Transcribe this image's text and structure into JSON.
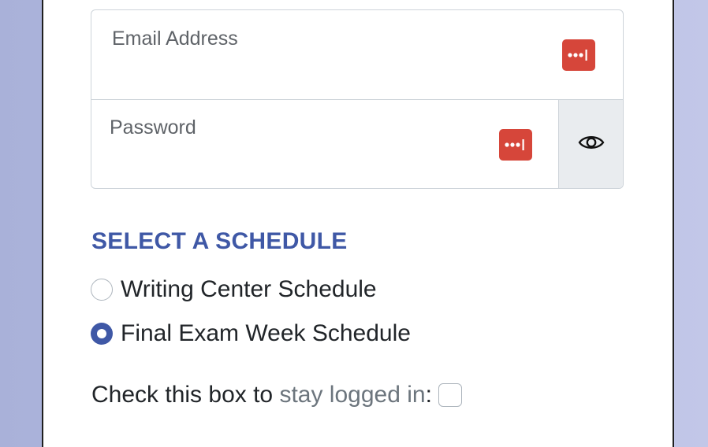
{
  "login": {
    "email": {
      "label": "Email Address",
      "value": ""
    },
    "password": {
      "label": "Password",
      "value": ""
    },
    "icons": {
      "password_manager": "password-manager-icon",
      "show_password": "eye-icon"
    }
  },
  "schedule": {
    "heading": "SELECT A SCHEDULE",
    "options": [
      {
        "label": "Writing Center Schedule",
        "checked": false
      },
      {
        "label": "Final Exam Week Schedule",
        "checked": true
      }
    ]
  },
  "stay_logged_in": {
    "prefix": "Check this box to ",
    "link_text": "stay logged in",
    "suffix": ":",
    "checked": false
  },
  "colors": {
    "accent": "#3f58a6",
    "password_manager": "#d6463a",
    "background": "#b4bbe0"
  }
}
